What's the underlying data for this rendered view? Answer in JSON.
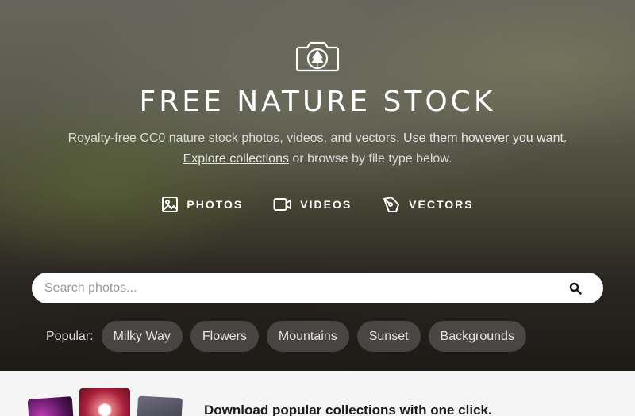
{
  "hero": {
    "title": "FREE NATURE STOCK",
    "tagline_prefix": "Royalty-free CC0 nature stock photos, videos, and vectors. ",
    "tagline_link1": "Use them however you want",
    "tagline_period": ".",
    "tagline_link2": "Explore collections",
    "tagline_suffix": " or browse by file type below."
  },
  "filetypes": [
    {
      "label": "PHOTOS",
      "icon": "image-icon"
    },
    {
      "label": "VIDEOS",
      "icon": "video-camera-icon"
    },
    {
      "label": "VECTORS",
      "icon": "pen-tool-icon"
    }
  ],
  "search": {
    "placeholder": "Search photos...",
    "icon": "search-icon"
  },
  "popular": {
    "label": "Popular:",
    "chips": [
      "Milky Way",
      "Flowers",
      "Mountains",
      "Sunset",
      "Backgrounds"
    ]
  },
  "promo": {
    "text": "Download popular collections with one click."
  },
  "logo": {
    "icon": "camera-tree-logo-icon"
  }
}
